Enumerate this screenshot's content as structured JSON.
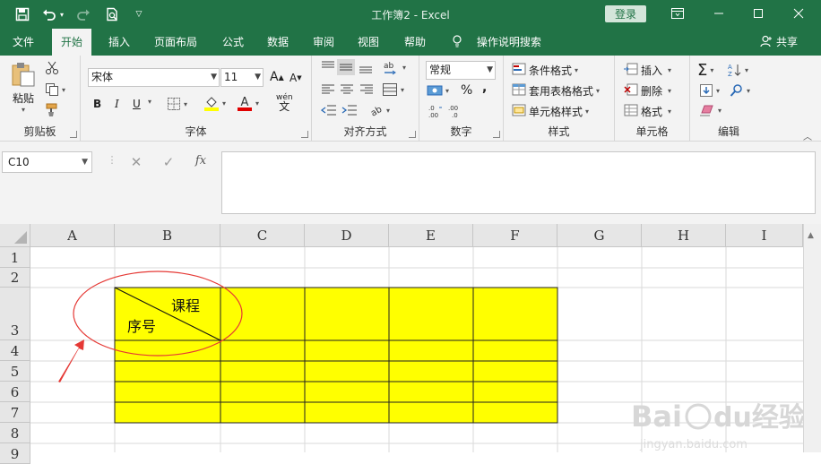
{
  "title_bar": {
    "title": "工作簿2 - Excel",
    "login_label": "登录",
    "icons": [
      "save-icon",
      "undo-icon",
      "redo-icon",
      "print-preview-icon",
      "customize-quick-access-icon",
      "ribbon-display-options-icon",
      "minimize-icon",
      "maximize-icon",
      "close-icon"
    ]
  },
  "tabs": [
    {
      "label": "文件"
    },
    {
      "label": "开始"
    },
    {
      "label": "插入"
    },
    {
      "label": "页面布局"
    },
    {
      "label": "公式"
    },
    {
      "label": "数据"
    },
    {
      "label": "审阅"
    },
    {
      "label": "视图"
    },
    {
      "label": "帮助"
    },
    {
      "label": "操作说明搜索"
    }
  ],
  "share_label": "共享",
  "ribbon": {
    "clipboard": {
      "label": "剪贴板",
      "paste_label": "粘贴"
    },
    "font": {
      "label": "字体",
      "font_name": "宋体",
      "font_size": "11",
      "bold": "B",
      "italic": "I",
      "underline": "U",
      "increase": "A",
      "decrease": "A",
      "phonetic": "wén"
    },
    "alignment": {
      "label": "对齐方式"
    },
    "number": {
      "label": "数字",
      "format": "常规",
      "percent": "%",
      "comma": ","
    },
    "styles": {
      "label": "样式",
      "conditional": "条件格式",
      "table_format": "套用表格格式",
      "cell_styles": "单元格样式"
    },
    "cells": {
      "label": "单元格",
      "insert": "插入",
      "delete": "删除",
      "format": "格式"
    },
    "editing": {
      "label": "编辑"
    }
  },
  "formula_bar": {
    "name_box": "C10",
    "cancel": "✕",
    "confirm": "✓",
    "fx": "fx",
    "value": ""
  },
  "sheet": {
    "columns": [
      "A",
      "B",
      "C",
      "D",
      "E",
      "F",
      "G",
      "H",
      "I"
    ],
    "rows": [
      "1",
      "2",
      "3",
      "4",
      "5",
      "6",
      "7",
      "8",
      "9"
    ],
    "header_top_right": "课程",
    "header_bottom_left": "序号",
    "fill_color": "#ffff00",
    "annotation_color": "#e53935"
  },
  "colors": {
    "excel_green": "#217346",
    "ribbon_bg": "#f3f3f3",
    "header_bg": "#e6e6e6"
  }
}
